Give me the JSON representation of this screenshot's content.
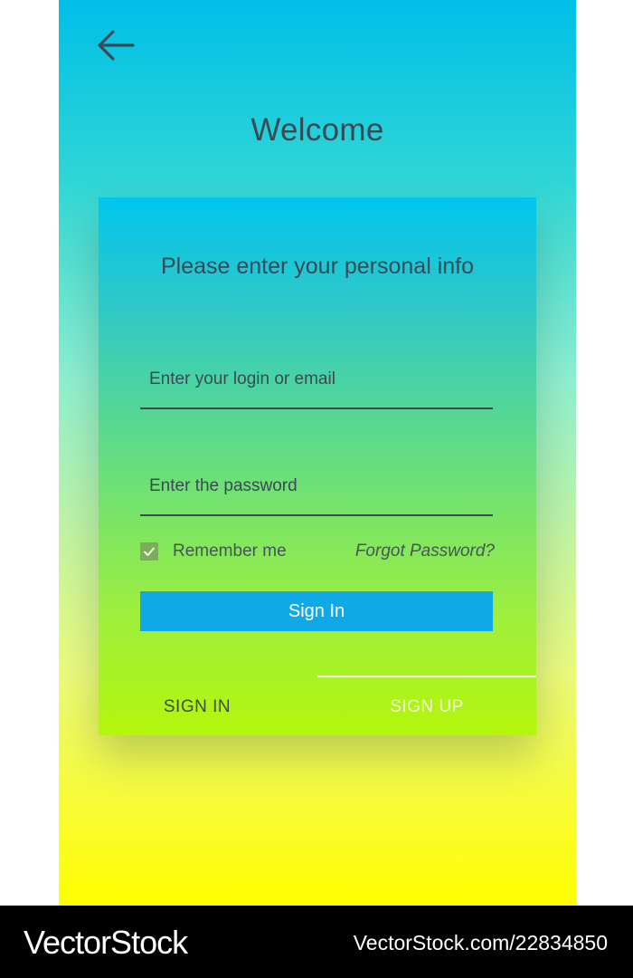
{
  "header": {
    "back_icon": "arrow-left-icon",
    "title": "Welcome"
  },
  "form": {
    "title": "Please enter your personal info",
    "login_placeholder": "Enter your login or email",
    "password_placeholder": "Enter the password",
    "remember_label": "Remember me",
    "remember_checked": true,
    "forgot_label": "Forgot Password?",
    "submit_label": "Sign In"
  },
  "tabs": [
    {
      "label": "SIGN IN",
      "active": false
    },
    {
      "label": "SIGN UP",
      "active": true
    }
  ],
  "watermark": {
    "brand": "VectorStock",
    "url": "VectorStock.com/22834850"
  },
  "colors": {
    "button": "#10a9e8",
    "checkbox": "#7cae5a",
    "text_dark": "#3a4a55"
  }
}
